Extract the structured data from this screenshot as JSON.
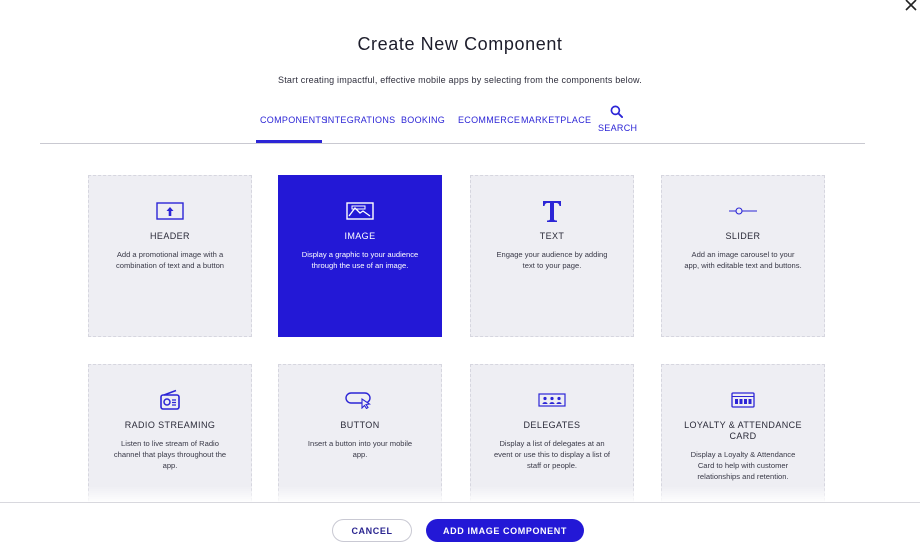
{
  "dialog": {
    "title": "Create New Component",
    "subtitle": "Start creating impactful, effective mobile apps by selecting from the components below."
  },
  "tabs": [
    {
      "label": "COMPONENTS",
      "active": true
    },
    {
      "label": "INTEGRATIONS",
      "active": false
    },
    {
      "label": "BOOKING",
      "active": false
    },
    {
      "label": "ECOMMERCE",
      "active": false
    },
    {
      "label": "MARKETPLACE",
      "active": false
    }
  ],
  "search": {
    "label": "SEARCH",
    "icon": "search-icon"
  },
  "accent_color": "#2318d6",
  "components": [
    {
      "title": "HEADER",
      "description": "Add a promotional image with a combination of text and a button",
      "icon": "header-icon",
      "selected": false
    },
    {
      "title": "IMAGE",
      "description": "Display a graphic to your audience through the use of an image.",
      "icon": "image-icon",
      "selected": true
    },
    {
      "title": "TEXT",
      "description": "Engage your audience by adding text to your page.",
      "icon": "text-icon",
      "selected": false
    },
    {
      "title": "SLIDER",
      "description": "Add an image carousel to your app, with editable text and buttons.",
      "icon": "slider-icon",
      "selected": false
    },
    {
      "title": "RADIO STREAMING",
      "description": "Listen to live stream of Radio channel that plays throughout the app.",
      "icon": "radio-icon",
      "selected": false
    },
    {
      "title": "BUTTON",
      "description": "Insert a button into your mobile app.",
      "icon": "button-icon",
      "selected": false
    },
    {
      "title": "DELEGATES",
      "description": "Display a list of delegates at an event or use this to display a list of staff or people.",
      "icon": "delegates-icon",
      "selected": false
    },
    {
      "title": "LOYALTY & ATTENDANCE CARD",
      "description": "Display a Loyalty & Attendance Card to help with customer relationships and retention.",
      "icon": "loyalty-card-icon",
      "selected": false
    }
  ],
  "footer": {
    "cancel_label": "CANCEL",
    "add_label": "ADD IMAGE COMPONENT"
  }
}
